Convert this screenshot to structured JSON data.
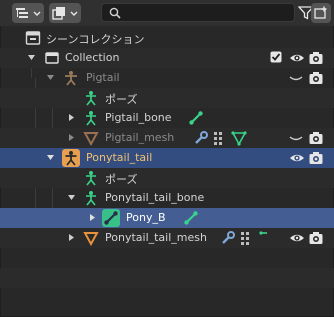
{
  "header": {
    "display_mode_icon": "outliner-display-icon",
    "filter_icon": "funnel-icon",
    "new_collection_icon": "new-collection-icon",
    "search": {
      "value": "",
      "placeholder": ""
    }
  },
  "tree": {
    "scene_collection": "シーンコレクション",
    "collection": "Collection",
    "pigtail": "Pigtail",
    "pigtail_pose": "ポーズ",
    "pigtail_bone": "Pigtail_bone",
    "pigtail_mesh": "Pigtail_mesh",
    "ponytail": "Ponytail_tail",
    "ponytail_pose": "ポーズ",
    "ponytail_bone": "Ponytail_tail_bone",
    "pony_b": "Pony_B",
    "ponytail_mesh": "Ponytail_tail_mesh"
  },
  "colors": {
    "bone_green": "#39d38a",
    "armature_orange": "#e8a050",
    "mesh_orange": "#e8923c",
    "active_row": "#334d80",
    "selected_row": "#445e94"
  }
}
